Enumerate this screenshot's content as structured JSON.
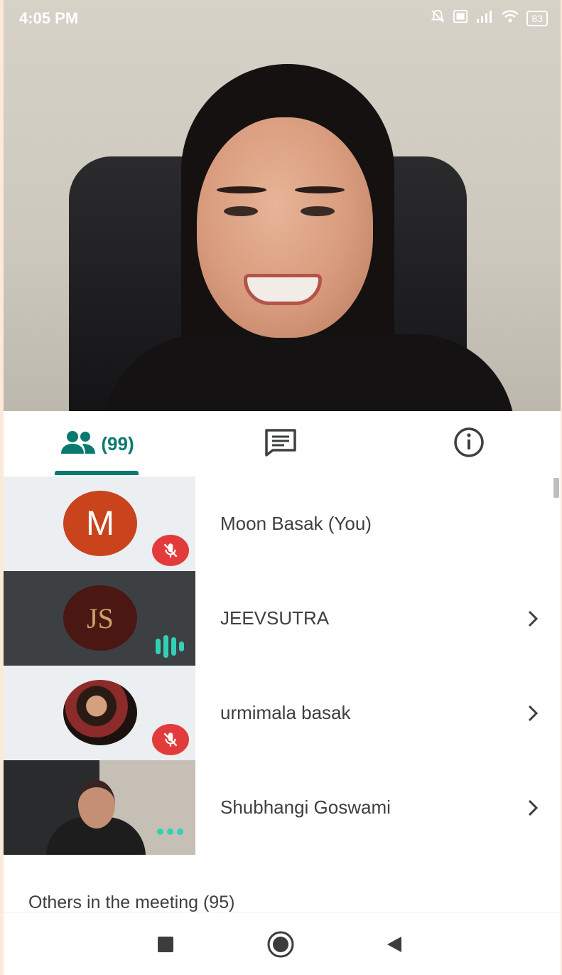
{
  "status_bar": {
    "time": "4:05 PM",
    "battery": "83"
  },
  "tabs": {
    "people_count": "(99)"
  },
  "participants": [
    {
      "name": "Moon Basak (You)",
      "initial": "M",
      "state": "muted"
    },
    {
      "name": "JEEVSUTRA",
      "initial": "JS",
      "state": "speaking"
    },
    {
      "name": "urmimala basak",
      "state": "muted"
    },
    {
      "name": "Shubhangi Goswami",
      "state": "active"
    }
  ],
  "others_label": "Others in the meeting (95)",
  "colors": {
    "accent": "#0b7a6e",
    "mute_red": "#e33b3b",
    "speak_teal": "#33d1b4",
    "avatar_orange": "#c9431d"
  },
  "icons": {
    "people": "people-icon",
    "chat": "chat-icon",
    "info": "info-icon",
    "mute": "mic-off-icon",
    "chevron": "chevron-right-icon",
    "nav_recents": "square-icon",
    "nav_home": "circle-icon",
    "nav_back": "triangle-back-icon"
  }
}
